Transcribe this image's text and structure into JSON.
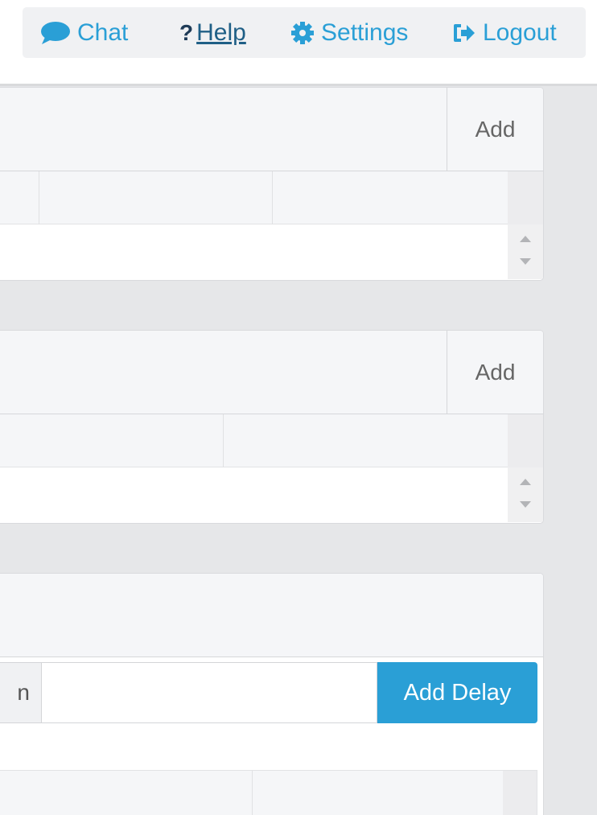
{
  "nav": {
    "chat_label": "Chat",
    "help_mark": "?",
    "help_label": "Help",
    "settings_label": "Settings",
    "logout_label": "Logout",
    "icons": [
      "chat-bubble-icon",
      "question-icon",
      "gear-icon",
      "logout-icon"
    ],
    "accent": "#2a9fd6"
  },
  "panel1": {
    "add_label": "Add"
  },
  "panel2": {
    "add_label": "Add"
  },
  "panel3": {
    "delay_label_fragment": "n",
    "delay_input_value": "",
    "add_delay_label": "Add Delay"
  }
}
